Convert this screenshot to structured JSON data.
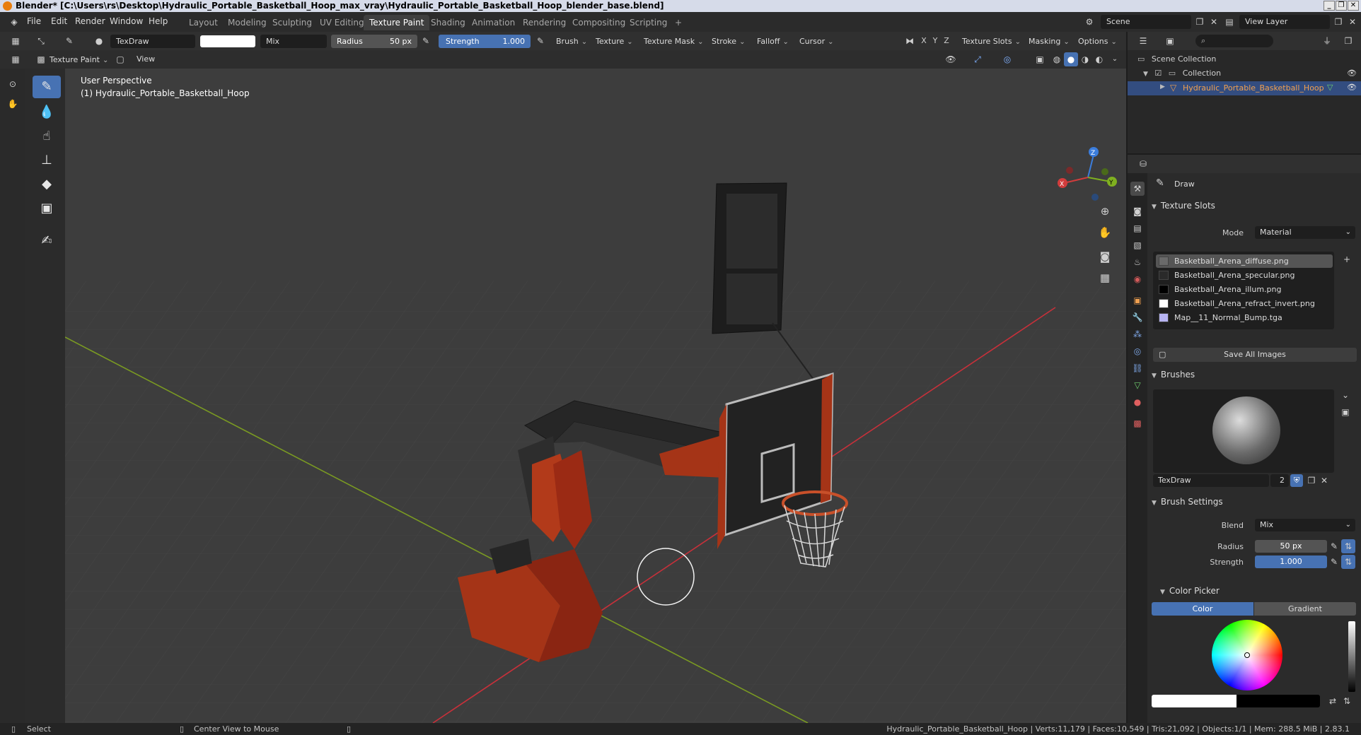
{
  "window": {
    "title": "Blender* [C:\\Users\\rs\\Desktop\\Hydraulic_Portable_Basketball_Hoop_max_vray\\Hydraulic_Portable_Basketball_Hoop_blender_base.blend]",
    "buttons": [
      "_",
      "❐",
      "✕"
    ]
  },
  "menubar": {
    "items": [
      "File",
      "Edit",
      "Render",
      "Window",
      "Help"
    ],
    "workspace_tabs": [
      "Layout",
      "Modeling",
      "Sculpting",
      "UV Editing",
      "Texture Paint",
      "Shading",
      "Animation",
      "Rendering",
      "Compositing",
      "Scripting"
    ],
    "active_tab": "Texture Paint",
    "add_tab": "+",
    "scene": "Scene",
    "view_layer": "View Layer"
  },
  "toolheader": {
    "brush_name": "TexDraw",
    "blend": "Mix",
    "radius_label": "Radius",
    "radius_value": "50 px",
    "strength_label": "Strength",
    "strength_value": "1.000",
    "menus": [
      "Brush",
      "Texture",
      "Texture Mask",
      "Stroke",
      "Falloff",
      "Cursor"
    ],
    "axes": [
      "X",
      "Y",
      "Z"
    ],
    "right_menus": [
      "Texture Slots",
      "Masking",
      "Options"
    ]
  },
  "subheader": {
    "mode": "Texture Paint",
    "view": "View"
  },
  "viewport": {
    "perspective": "User Perspective",
    "object_label": "(1) Hydraulic_Portable_Basketball_Hoop",
    "gizmo_axes": [
      "X",
      "Y",
      "Z"
    ]
  },
  "outliner": {
    "scene_collection": "Scene Collection",
    "collection": "Collection",
    "object": "Hydraulic_Portable_Basketball_Hoop"
  },
  "properties": {
    "tool_name": "Draw",
    "texture_slots": {
      "title": "Texture Slots",
      "mode_label": "Mode",
      "mode_value": "Material",
      "slots": [
        {
          "name": "Basketball_Arena_diffuse.png",
          "color": "#6a6a6a"
        },
        {
          "name": "Basketball_Arena_specular.png",
          "color": "#2a2a2a"
        },
        {
          "name": "Basketball_Arena_illum.png",
          "color": "#000000"
        },
        {
          "name": "Basketball_Arena_refract_invert.png",
          "color": "#ffffff"
        },
        {
          "name": "Map__11_Normal_Bump.tga",
          "color": "#b7b4f2"
        }
      ],
      "save_all": "Save All Images"
    },
    "brushes": {
      "title": "Brushes",
      "brush_name": "TexDraw",
      "users": "2"
    },
    "brush_settings": {
      "title": "Brush Settings",
      "blend_label": "Blend",
      "blend_value": "Mix",
      "radius_label": "Radius",
      "radius_value": "50 px",
      "strength_label": "Strength",
      "strength_value": "1.000"
    },
    "color_picker": {
      "title": "Color Picker",
      "tab_color": "Color",
      "tab_gradient": "Gradient"
    }
  },
  "statusbar": {
    "select": "Select",
    "center": "Center View to Mouse",
    "stats": "Hydraulic_Portable_Basketball_Hoop | Verts:11,179 | Faces:10,549 | Tris:21,092 | Objects:1/1 | Mem: 288.5 MiB | 2.83.1"
  },
  "colors": {
    "accent": "#4772b3",
    "selected_object": "#f0a050",
    "hoop_red": "#9b2a14",
    "axis_red": "#c8303a",
    "axis_green": "#7a9a22"
  }
}
